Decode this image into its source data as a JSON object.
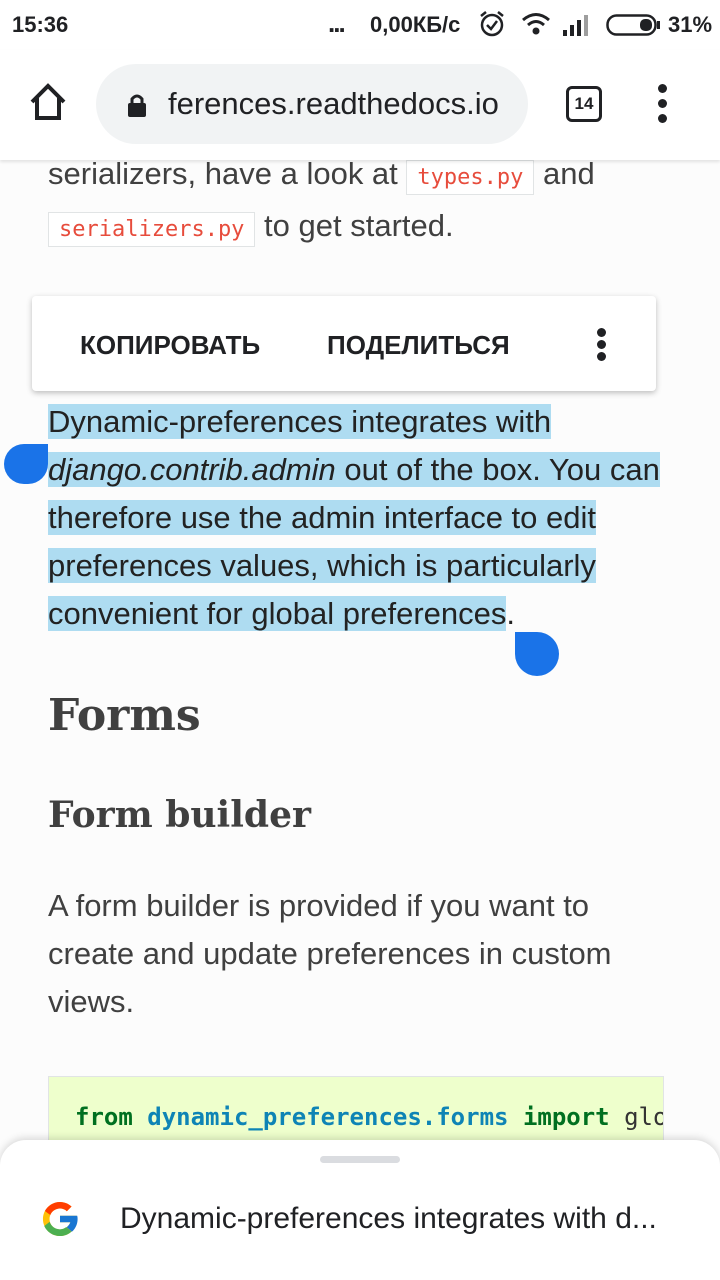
{
  "status_bar": {
    "time": "15:36",
    "dots": "...",
    "speed": "0,00КБ/с",
    "battery_percent": "31%",
    "icons": [
      "alarm-icon",
      "wifi-icon",
      "signal-icon",
      "battery-icon"
    ]
  },
  "browser": {
    "url": "ferences.readthedocs.io",
    "tab_count": "14"
  },
  "content": {
    "intro": {
      "before_types": "serializers, have a look at ",
      "types_code": "types.py",
      "and": " and",
      "serializers_code": "serializers.py",
      "after": " to get started."
    },
    "context_menu": {
      "copy": "КОПИРОВАТЬ",
      "share": "ПОДЕЛИТЬСЯ"
    },
    "selected": {
      "part1": "Dynamic-preferences integrates with ",
      "italic": "django.contrib.admin",
      "part2": " out of the box. You can therefore use the admin interface to edit preferences values, which is particularly convenient for global preferences",
      "trailing_dot": "."
    },
    "heading_forms": "Forms",
    "heading_form_builder": "Form builder",
    "form_para": "A form builder is provided if you want to create and update preferences in custom views.",
    "code": {
      "kw_from": "from",
      "module": "dynamic_preferences.forms",
      "kw_import": "import",
      "rest": "glo"
    }
  },
  "bottom_sheet": {
    "text": "Dynamic-preferences integrates with d..."
  },
  "colors": {
    "selection": "#aedcf1",
    "handle": "#1a73e8",
    "code_bg": "#eeffcc",
    "inline_code": "#e74c3c"
  }
}
